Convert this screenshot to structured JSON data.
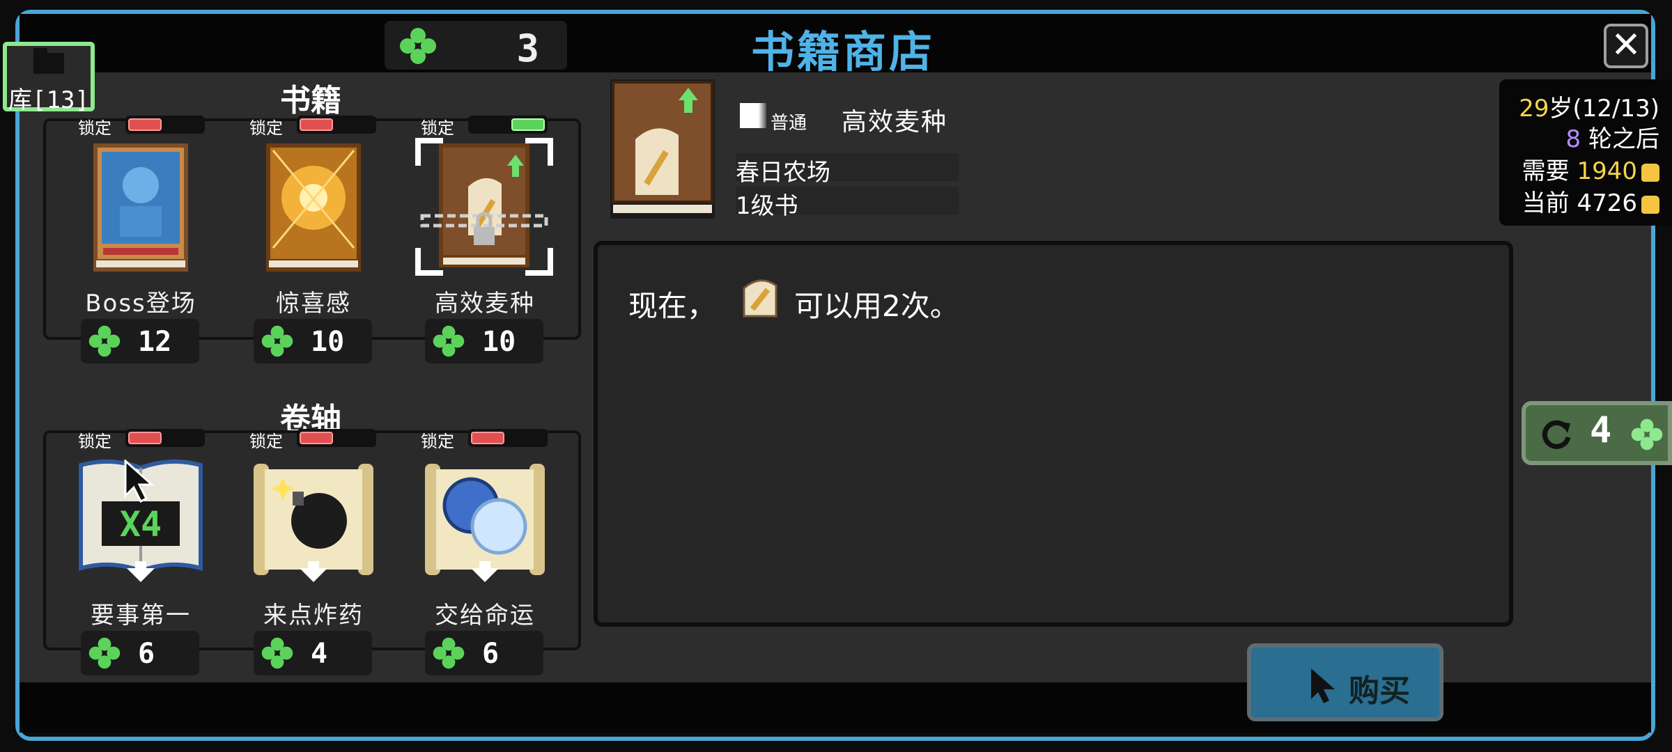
{
  "header": {
    "title": "书籍商店",
    "clover_count": "3"
  },
  "library": {
    "label": "库[13]"
  },
  "books": {
    "section_title": "书籍",
    "items": [
      {
        "lock_label": "锁定",
        "locked": false,
        "name": "Boss登场",
        "price": "12"
      },
      {
        "lock_label": "锁定",
        "locked": false,
        "name": "惊喜感",
        "price": "10"
      },
      {
        "lock_label": "锁定",
        "locked": true,
        "name": "高效麦种",
        "price": "10"
      }
    ]
  },
  "scrolls": {
    "section_title": "卷轴",
    "items": [
      {
        "lock_label": "锁定",
        "locked": false,
        "name": "要事第一",
        "price": "6",
        "badge": "X4"
      },
      {
        "lock_label": "锁定",
        "locked": false,
        "name": "来点炸药",
        "price": "4"
      },
      {
        "lock_label": "锁定",
        "locked": false,
        "name": "交给命运",
        "price": "6"
      }
    ]
  },
  "detail": {
    "rarity": "普通",
    "name": "高效麦种",
    "tags": [
      "春日农场",
      "1级书"
    ],
    "description_prefix": "现在，",
    "description_suffix": "可以用2次。"
  },
  "stats": {
    "age_value": "29",
    "age_text": "岁(12/13)",
    "rounds_value": "8",
    "rounds_text": "轮之后",
    "need_label": "需要",
    "need_value": "1940",
    "current_label": "当前",
    "current_value": "4726"
  },
  "reroll": {
    "cost": "4"
  },
  "buy": {
    "label": "购买"
  },
  "colors": {
    "accent_blue": "#4fb3e8",
    "clover_green": "#5bd35b",
    "lock_red": "#e05050",
    "buy_blue": "#2a6e91"
  }
}
